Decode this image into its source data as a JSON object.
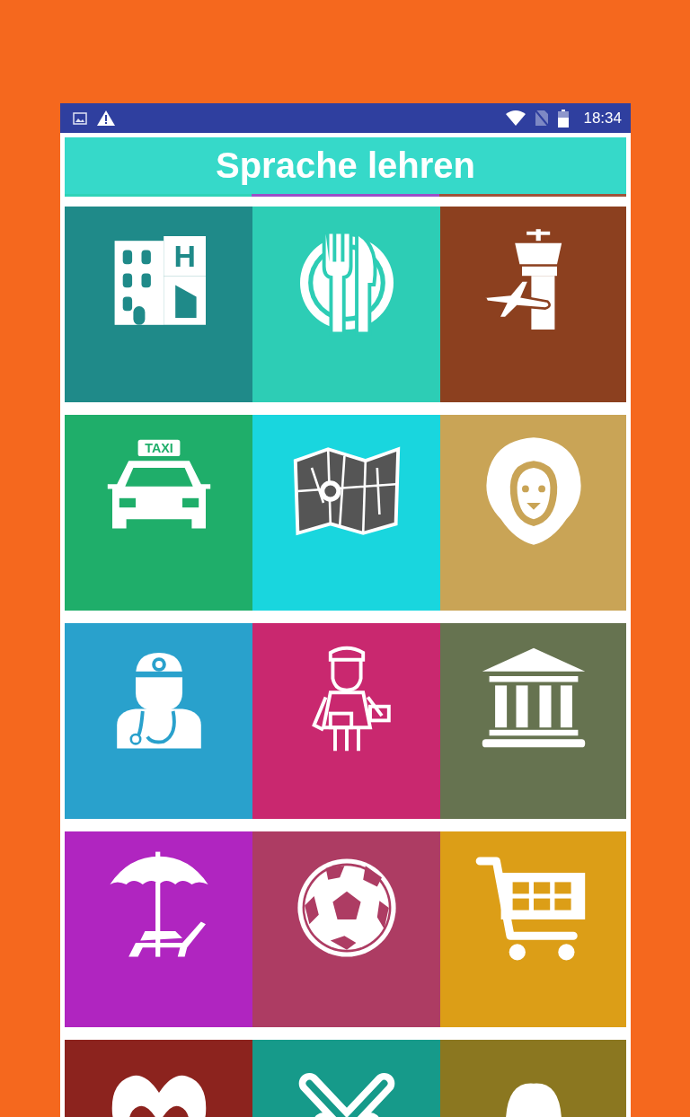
{
  "status_bar": {
    "time": "18:34"
  },
  "header": {
    "title": "Sprache lehren"
  },
  "indicator": [
    {
      "color": "#2fd3b8"
    },
    {
      "color": "#9b4fc8"
    },
    {
      "color": "#a0523a"
    }
  ],
  "tiles": [
    {
      "kind": "hotel",
      "color": "#1f8a89",
      "sign": "H"
    },
    {
      "kind": "restaurant",
      "color": "#2dcdb5"
    },
    {
      "kind": "airport",
      "color": "#8c401f"
    },
    {
      "kind": "taxi",
      "color": "#1fae6a",
      "sign": "TAXI"
    },
    {
      "kind": "map",
      "color": "#19d6de"
    },
    {
      "kind": "zoo",
      "color": "#c9a456"
    },
    {
      "kind": "doctor",
      "color": "#29a1cc"
    },
    {
      "kind": "postman",
      "color": "#c9286f"
    },
    {
      "kind": "museum",
      "color": "#667350"
    },
    {
      "kind": "beach",
      "color": "#b025c0"
    },
    {
      "kind": "football",
      "color": "#ad3c63"
    },
    {
      "kind": "shopping",
      "color": "#dc9e17"
    },
    {
      "kind": "heart",
      "color": "#8c231e"
    },
    {
      "kind": "chevron",
      "color": "#169a8a"
    },
    {
      "kind": "egg",
      "color": "#8b7720"
    }
  ]
}
